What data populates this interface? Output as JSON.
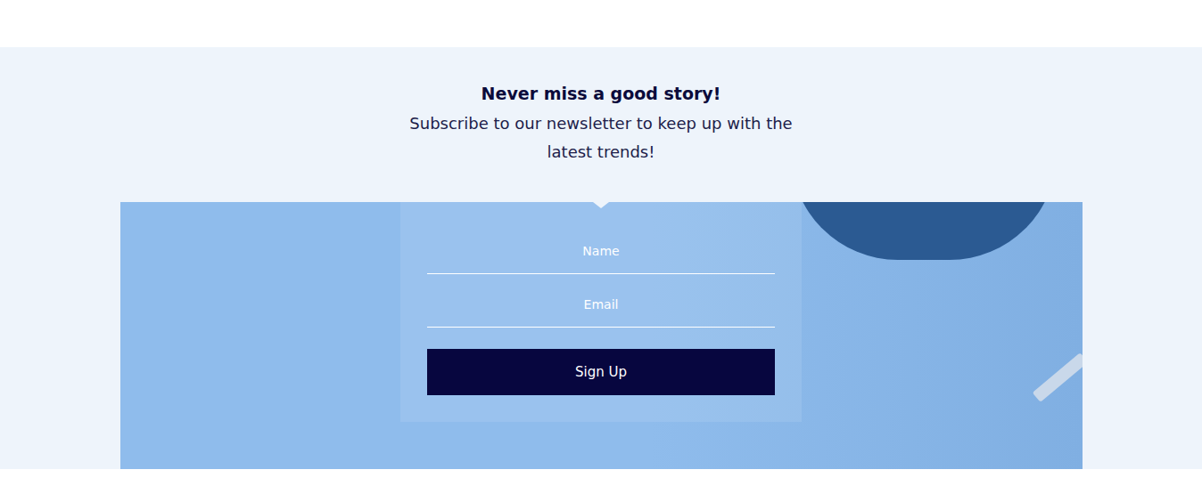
{
  "newsletter": {
    "heading": "Never miss a good story!",
    "subtitle": "Subscribe to our newsletter to keep up with the latest trends!"
  },
  "form": {
    "fields": [
      {
        "placeholder": "Name"
      },
      {
        "placeholder": "Email"
      }
    ],
    "button": "Sign Up"
  }
}
